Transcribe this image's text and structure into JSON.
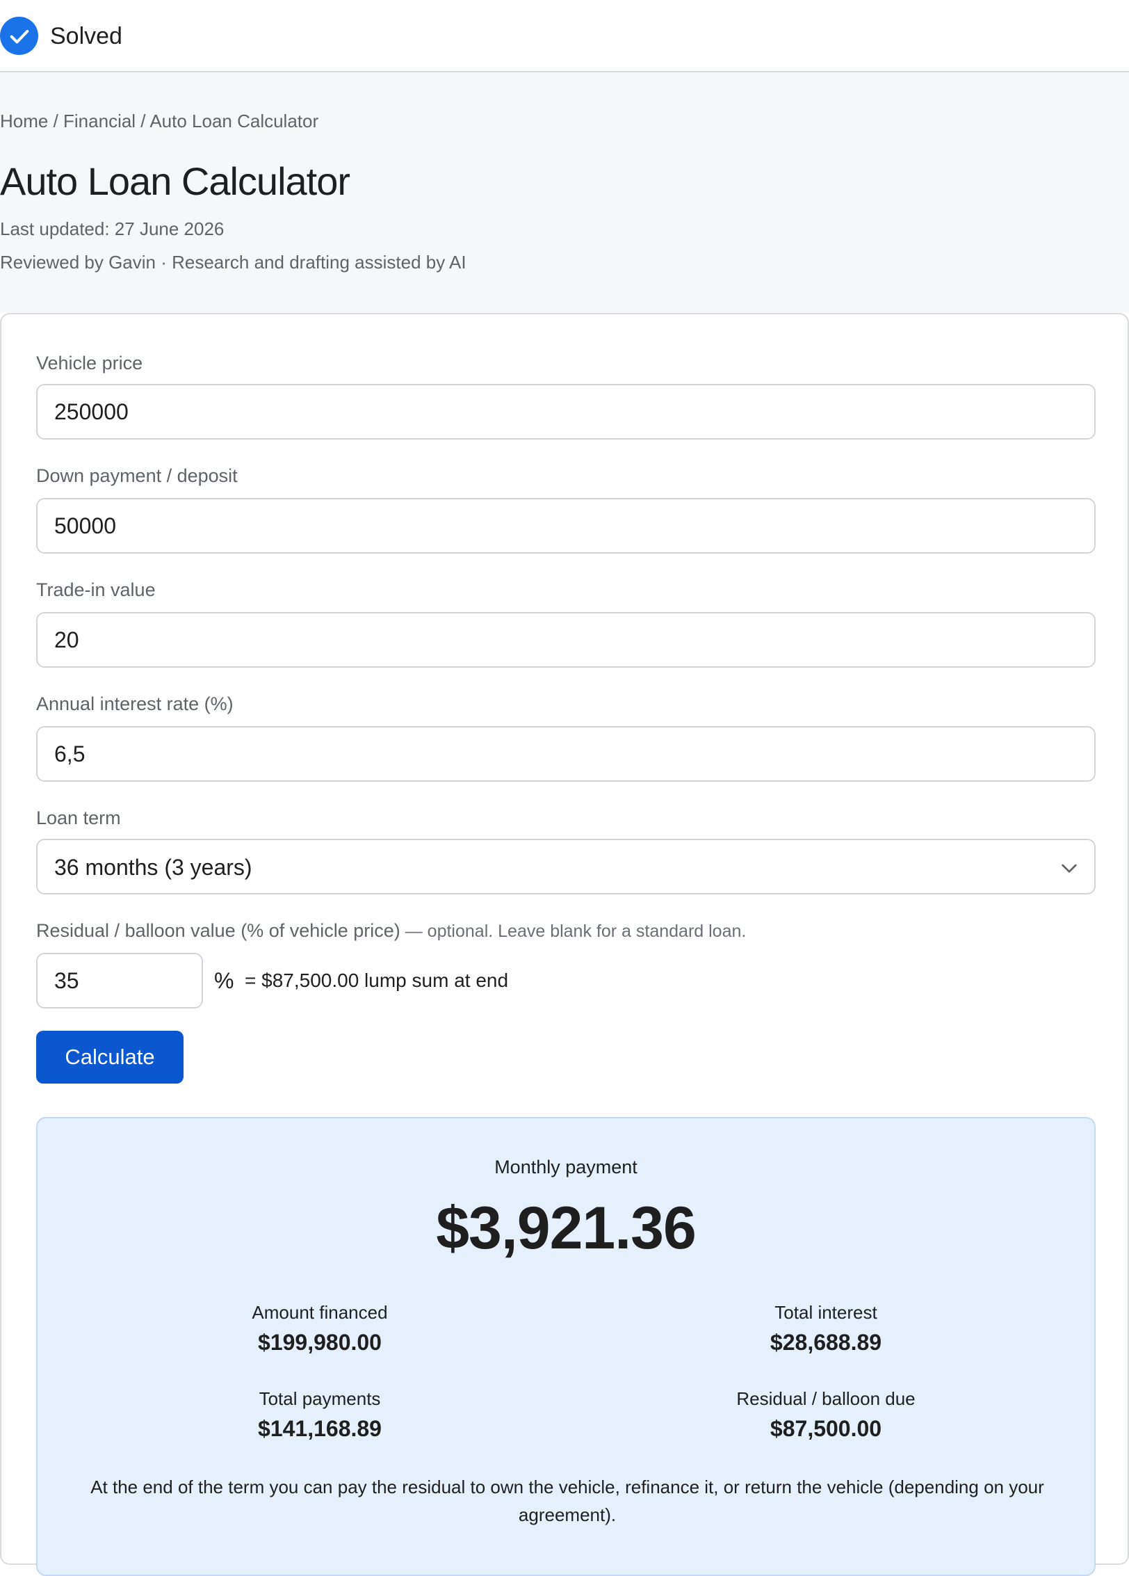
{
  "status": {
    "label": "Solved",
    "icon": "check-circle-icon",
    "color": "#1a73e8"
  },
  "header": {
    "breadcrumb": "Home / Financial / Auto Loan Calculator",
    "title": "Auto Loan Calculator",
    "last_updated": "Last updated: 27 June 2026",
    "reviewed": "Reviewed by Gavin · Research and drafting assisted by AI"
  },
  "form": {
    "vehicle_price": {
      "label": "Vehicle price",
      "value": "250000"
    },
    "down_payment": {
      "label": "Down payment / deposit",
      "value": "50000"
    },
    "trade_in": {
      "label": "Trade-in value",
      "value": "20"
    },
    "interest_rate": {
      "label": "Annual interest rate (%)",
      "value": "6,5"
    },
    "loan_term": {
      "label": "Loan term",
      "selected": "36 months (3 years)"
    },
    "residual": {
      "label": "Residual / balloon value (% of vehicle price)",
      "hint": " — optional. Leave blank for a standard loan.",
      "value": "35",
      "unit": "%",
      "lump_text": "= $87,500.00 lump sum at end"
    },
    "calculate_label": "Calculate",
    "button_color": "#0b57d0"
  },
  "results": {
    "monthly_label": "Monthly payment",
    "monthly_value": "$3,921.36",
    "amount_financed": {
      "label": "Amount financed",
      "value": "$199,980.00"
    },
    "total_interest": {
      "label": "Total interest",
      "value": "$28,688.89"
    },
    "total_payments": {
      "label": "Total payments",
      "value": "$141,168.89"
    },
    "residual_due": {
      "label": "Residual / balloon due",
      "value": "$87,500.00"
    },
    "note": "At the end of the term you can pay the residual to own the vehicle, refinance it, or return the vehicle (depending on your agreement).",
    "background": "#e6f0fc"
  }
}
